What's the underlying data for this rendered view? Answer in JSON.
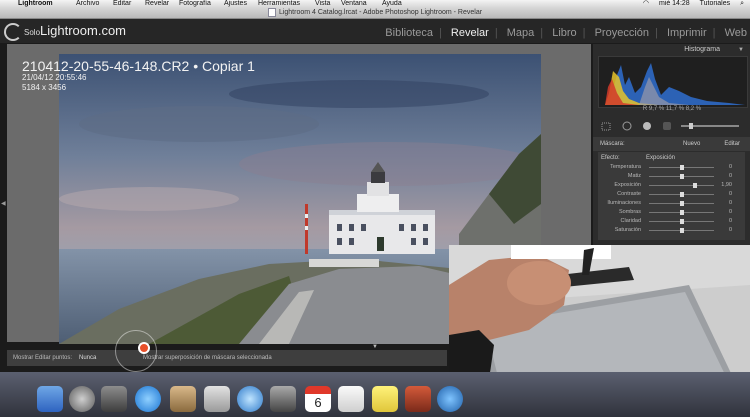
{
  "menubar": {
    "app": "Lightroom",
    "items": [
      "Archivo",
      "Editar",
      "Revelar",
      "Fotografía",
      "Ajustes",
      "Herramientas",
      "Vista",
      "Ventana",
      "Ayuda"
    ],
    "clock": "mié 14:28",
    "tutorials": "Tutoriales"
  },
  "window": {
    "title": "Lightroom 4 Catalog.lrcat - Adobe Photoshop Lightroom - Revelar"
  },
  "logo": {
    "prefix": "Solo",
    "name": "Lightroom",
    "suffix": ".com"
  },
  "modules": [
    "Biblioteca",
    "Revelar",
    "Mapa",
    "Libro",
    "Proyección",
    "Imprimir",
    "Web"
  ],
  "active_module": "Revelar",
  "photo_info": {
    "filename": "210412-20-55-46-148.CR2 • Copiar 1",
    "datetime": "21/04/12 20:55:46",
    "dimensions": "5184 x 3456"
  },
  "histogram": {
    "title": "Histograma",
    "values": "R  9,7  %  11,7  %  8,2  %"
  },
  "mask_panel": {
    "label": "Máscara:",
    "new": "Nuevo",
    "edit": "Editar",
    "effect_label": "Efecto:",
    "effect_value": "Exposición",
    "rows": [
      {
        "label": "Temperatura",
        "pos": 0.5,
        "value": "0"
      },
      {
        "label": "Matiz",
        "pos": 0.5,
        "value": "0"
      },
      {
        "label": "Exposición",
        "pos": 0.7,
        "value": "1,90"
      },
      {
        "label": "Contraste",
        "pos": 0.5,
        "value": "0"
      },
      {
        "label": "Iluminaciones",
        "pos": 0.5,
        "value": "0"
      },
      {
        "label": "Sombras",
        "pos": 0.5,
        "value": "0"
      },
      {
        "label": "Claridad",
        "pos": 0.5,
        "value": "0"
      },
      {
        "label": "Saturación",
        "pos": 0.5,
        "value": "0"
      }
    ]
  },
  "bottombar": {
    "show_pins_label": "Mostrar Editar puntos:",
    "show_pins_value": "Nunca",
    "overlay_label": "Mostrar superposición de máscara seleccionada"
  }
}
